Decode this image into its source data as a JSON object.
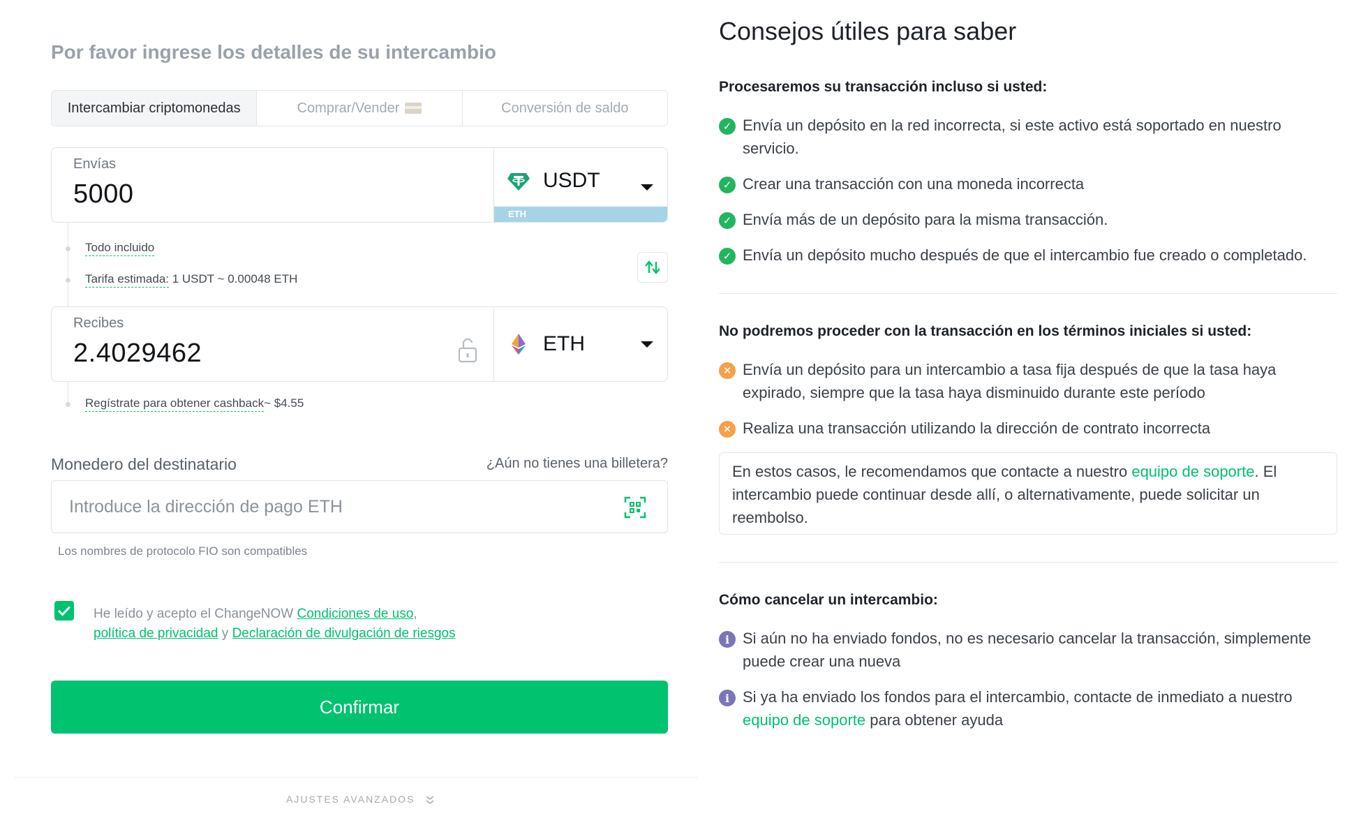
{
  "form": {
    "title": "Por favor ingrese los detalles de su intercambio",
    "tabs": [
      {
        "label": "Intercambiar criptomonedas",
        "active": true
      },
      {
        "label": "Comprar/Vender",
        "active": false
      },
      {
        "label": "Conversión de saldo",
        "active": false
      }
    ],
    "send": {
      "label": "Envías",
      "value": "5000",
      "currency": "USDT",
      "network": "ETH"
    },
    "rate": {
      "all_included": "Todo incluido",
      "estimated_label": "Tarifa estimada:",
      "estimated_value": " 1 USDT ~  0.00048 ETH"
    },
    "receive": {
      "label": "Recibes",
      "value": "2.4029462",
      "currency": "ETH"
    },
    "cashback": {
      "link": "Regístrate para obtener cashback",
      "value": "~ $4.55"
    },
    "wallet": {
      "label": "Monedero del destinatario",
      "no_wallet_link": "¿Aún no tienes una billetera?",
      "placeholder": "Introduce la dirección de pago ETH",
      "fio_note": "Los nombres de protocolo FIO son compatibles"
    },
    "terms": {
      "prefix": "He leído y acepto el ChangeNOW ",
      "terms_link": "Condiciones de uso",
      "comma": ",",
      "privacy_link": "política de privacidad",
      "and": " y ",
      "risk_link": "Declaración de divulgación de riesgos",
      "checked": true
    },
    "confirm_label": "Confirmar",
    "advanced_label": "AJUSTES AVANZADOS"
  },
  "tips": {
    "title": "Consejos útiles para saber",
    "section1": {
      "title": "Procesaremos su transacción incluso si usted:",
      "items": [
        "Envía un depósito en la red incorrecta, si este activo está soportado en nuestro servicio.",
        "Crear una transacción con una moneda incorrecta",
        "Envía más de un depósito para la misma transacción.",
        "Envía un depósito mucho después de que el intercambio fue creado o completado."
      ]
    },
    "section2": {
      "title": "No podremos proceder con la transacción en los términos iniciales si usted:",
      "items": [
        "Envía un depósito para un intercambio a tasa fija después de que la tasa haya expirado, siempre que la tasa haya disminuido durante este período",
        "Realiza una transacción utilizando la dirección de contrato incorrecta"
      ],
      "note_prefix": "En estos casos, le recomendamos que contacte a nuestro ",
      "note_link": "equipo de soporte",
      "note_suffix": ". El intercambio puede continuar desde allí, o alternativamente, puede solicitar un reembolso."
    },
    "section3": {
      "title": "Cómo cancelar un intercambio:",
      "item1": "Si aún no ha enviado fondos, no es necesario cancelar la transacción, simplemente puede crear una nueva",
      "item2_prefix": "Si ya ha enviado los fondos para el intercambio, contacte de inmediato a nuestro ",
      "item2_link": "equipo de soporte",
      "item2_suffix": " para obtener ayuda"
    }
  },
  "colors": {
    "accent": "#00c26f",
    "ok_icon": "#22b55f",
    "warn_icon": "#f5a04a",
    "info_icon": "#7b75b8",
    "network_badge": "#a6d4e6"
  },
  "icons": [
    "tether-icon",
    "ethereum-icon",
    "caret-down-icon",
    "swap-icon",
    "unlock-icon",
    "qr-scan-icon",
    "check-icon",
    "check-circle-icon",
    "warning-circle-icon",
    "info-circle-icon",
    "chevrons-down-icon",
    "card-icon"
  ]
}
